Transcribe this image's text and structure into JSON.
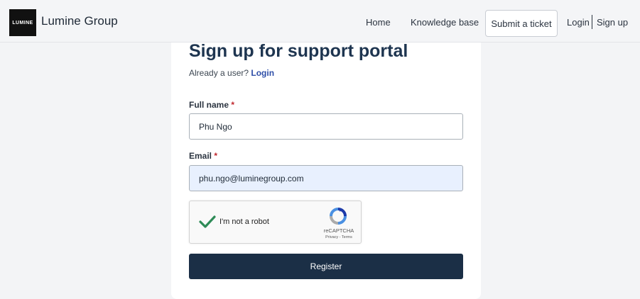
{
  "header": {
    "logo_text": "LUMINE",
    "brand_name": "Lumine Group",
    "nav": {
      "home": "Home",
      "knowledge_base": "Knowledge base",
      "submit_ticket": "Submit a ticket",
      "login": "Login",
      "signup": "Sign up"
    }
  },
  "form": {
    "title": "Sign up for support portal",
    "already_user": "Already a user?",
    "login_link": "Login",
    "full_name_label": "Full name",
    "full_name_value": "Phu Ngo",
    "email_label": "Email",
    "email_value": "phu.ngo@luminegroup.com",
    "required_marker": "*",
    "captcha": {
      "text": "I'm not a robot",
      "brand": "reCAPTCHA",
      "links": "Privacy - Terms",
      "checked": true
    },
    "register_label": "Register"
  },
  "colors": {
    "primary_button": "#1b2f46",
    "title": "#1e3550",
    "link": "#2f4fa8",
    "autofill_bg": "#e8f0fe",
    "check_green": "#2e8b57"
  }
}
